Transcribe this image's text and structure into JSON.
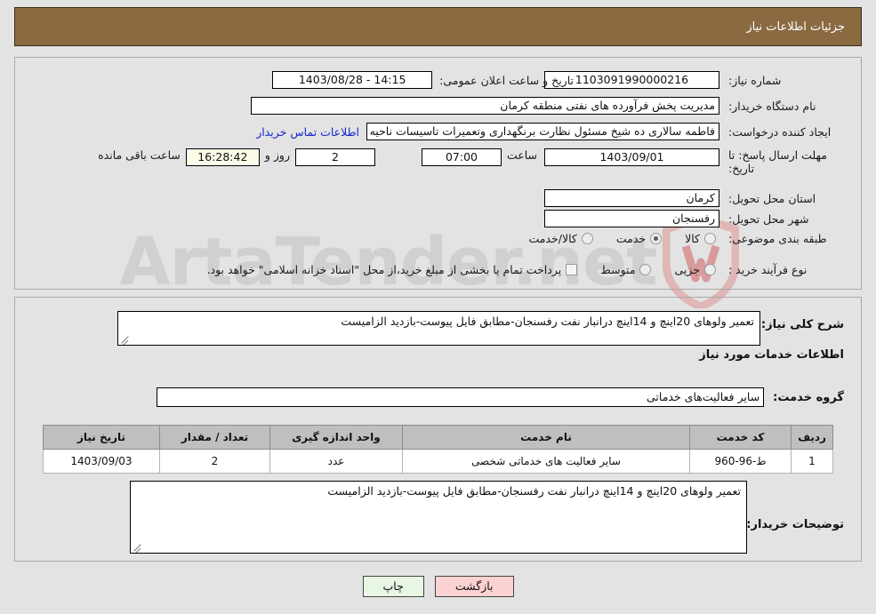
{
  "header": {
    "title": "جزئیات اطلاعات نیاز"
  },
  "watermark": {
    "text": "ArtaTender.net",
    "shield_color": "#d8a0a0"
  },
  "top_form": {
    "need_number": {
      "label": "شماره نیاز:",
      "value": "1103091990000216"
    },
    "announce_datetime": {
      "label": "تاریخ و ساعت اعلان عمومی:",
      "value": "14:15 - 1403/08/28"
    },
    "buyer_org": {
      "label": "نام دستگاه خریدار:",
      "value": "مدیریت پخش فرآورده های نفتی منطقه کرمان"
    },
    "requester": {
      "label": "ایجاد کننده درخواست:",
      "value": "فاطمه سالاری ده شیخ مسئول نظارت برنگهداری وتعمیرات تاسیسات ناحیه رفس",
      "contact_link": "اطلاعات تماس خریدار"
    },
    "deadline": {
      "label": "مهلت ارسال پاسخ: تا تاریخ:",
      "date": "1403/09/01",
      "time_label": "ساعت",
      "time": "07:00",
      "days": "2",
      "days_label": "روز و",
      "countdown": "16:28:42",
      "countdown_suffix": "ساعت باقی مانده"
    },
    "province": {
      "label": "استان محل تحویل:",
      "value": "کرمان"
    },
    "city": {
      "label": "شهر محل تحویل:",
      "value": "رفسنجان"
    },
    "category": {
      "label": "طبقه بندی موضوعی:",
      "options": [
        {
          "label": "کالا",
          "checked": false
        },
        {
          "label": "خدمت",
          "checked": true
        },
        {
          "label": "کالا/خدمت",
          "checked": false
        }
      ]
    },
    "purchase_process": {
      "label": "نوع فرآیند خرید :",
      "options": [
        {
          "label": "جزیی",
          "checked": false
        },
        {
          "label": "متوسط",
          "checked": false
        }
      ],
      "checkbox_note": "پرداخت تمام یا بخشی از مبلغ خرید،از محل \"اسناد خزانه اسلامی\" خواهد بود.",
      "checkbox_checked": false
    }
  },
  "description": {
    "label": "شرح کلی نیاز:",
    "value": "تعمیر ولوهای 20اینچ و 14اینچ درانبار نفت رفسنجان-مطابق فایل پیوست-بازدید الزامیست"
  },
  "services_section": {
    "title": "اطلاعات خدمات مورد نیاز",
    "group_label": "گروه خدمت:",
    "group_value": "سایر فعالیت‌های خدماتی"
  },
  "table": {
    "columns": [
      "ردیف",
      "کد خدمت",
      "نام خدمت",
      "واحد اندازه گیری",
      "تعداد / مقدار",
      "تاریخ نیاز"
    ],
    "rows": [
      [
        "1",
        "ط-96-960",
        "سایر فعالیت های خدماتی شخصی",
        "عدد",
        "2",
        "1403/09/03"
      ]
    ]
  },
  "buyer_notes": {
    "label": "توضیحات خریدار:",
    "value": "تعمیر ولوهای 20اینچ و 14اینچ درانبار نفت رفسنجان-مطابق فایل پیوست-بازدید الزامیست"
  },
  "buttons": {
    "back": "بازگشت",
    "print": "چاپ"
  }
}
